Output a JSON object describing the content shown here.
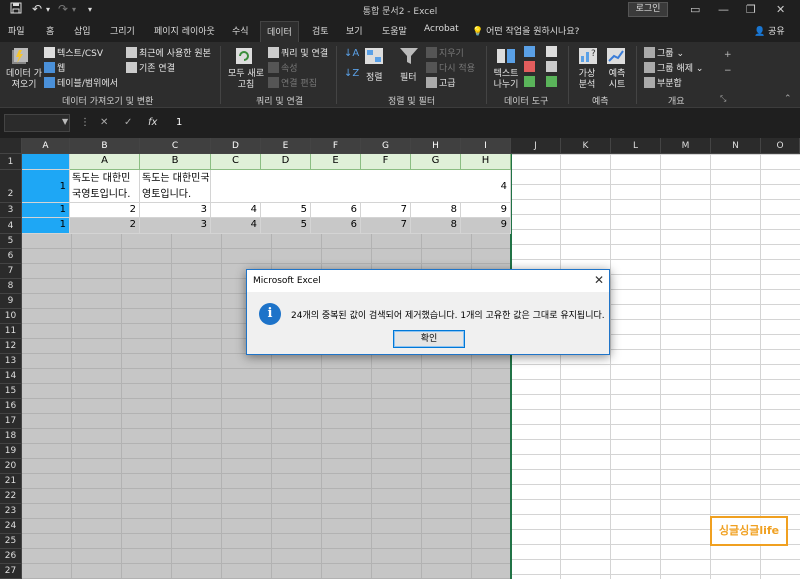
{
  "titlebar": {
    "doc_title": "통합 문서2  -  Excel",
    "login_label": "로그인",
    "minimize": "—",
    "restore": "❐",
    "close": "✕",
    "save_glyph": "💾",
    "undo_glyph": "↶",
    "redo_glyph": "↷",
    "customize_glyph": "▾"
  },
  "tabs": [
    "파일",
    "홈",
    "삽입",
    "그리기",
    "페이지 레이아웃",
    "수식",
    "데이터",
    "검토",
    "보기",
    "도움말",
    "Acrobat"
  ],
  "active_tab": "데이터",
  "search_hint": "어떤 작업을 원하시나요?",
  "share_label": "공유",
  "ribbon": {
    "get_data": "데이터 가져오기",
    "text_csv": "텍스트/CSV",
    "web": "웹",
    "table_range": "테이블/범위에서",
    "recent_sources": "최근에 사용한 원본",
    "existing_conn": "기존 연결",
    "group_get": "데이터 가져오기 및 변환",
    "refresh_all": "모두 새로 고침",
    "queries_conn": "쿼리 및 연결",
    "properties": "속성",
    "edit_links": "연결 편집",
    "group_queries": "쿼리 및 연결",
    "sort": "정렬",
    "filter": "필터",
    "clear": "지우기",
    "reapply": "다시 적용",
    "advanced": "고급",
    "group_sort": "정렬 및 필터",
    "text_to_cols": "텍스트 나누기",
    "group_tools": "데이터 도구",
    "what_if": "가상 분석",
    "forecast_sheet": "예측 시트",
    "group_forecast": "예측",
    "group_btn": "그룹",
    "ungroup_btn": "그룹 해제",
    "subtotal": "부분합",
    "group_outline": "개요"
  },
  "formula_bar": {
    "cancel": "✕",
    "enter": "✓",
    "fx": "fx",
    "value": "1"
  },
  "grid": {
    "columns": [
      "A",
      "B",
      "C",
      "D",
      "E",
      "F",
      "G",
      "H",
      "I",
      "J",
      "K",
      "L",
      "M",
      "N",
      "O"
    ],
    "rows": [
      "1",
      "2",
      "3",
      "4",
      "5",
      "6",
      "7",
      "8",
      "9",
      "10",
      "11",
      "12",
      "13",
      "14",
      "15",
      "16",
      "17",
      "18",
      "19",
      "20",
      "21",
      "22",
      "23",
      "24",
      "25",
      "26",
      "27"
    ],
    "header_row": [
      "A",
      "B",
      "C",
      "D",
      "E",
      "F",
      "G",
      "H"
    ],
    "row2": {
      "a": "1",
      "b": "독도는 대한민국영토입니다.",
      "c": "독도는 대한민국영토입니다.",
      "i": "4"
    },
    "row3": [
      "1",
      "2",
      "3",
      "4",
      "5",
      "6",
      "7",
      "8",
      "9"
    ],
    "row4": [
      "1",
      "2",
      "3",
      "4",
      "5",
      "6",
      "7",
      "8",
      "9"
    ]
  },
  "dialog": {
    "title": "Microsoft Excel",
    "icon": "i",
    "message": "24개의 중복된 값이 검색되어 제거했습니다. 1개의 고유한 값은 그대로 유지됩니다.",
    "ok_label": "확인",
    "close_glyph": "✕"
  },
  "watermark": "싱글싱글life"
}
